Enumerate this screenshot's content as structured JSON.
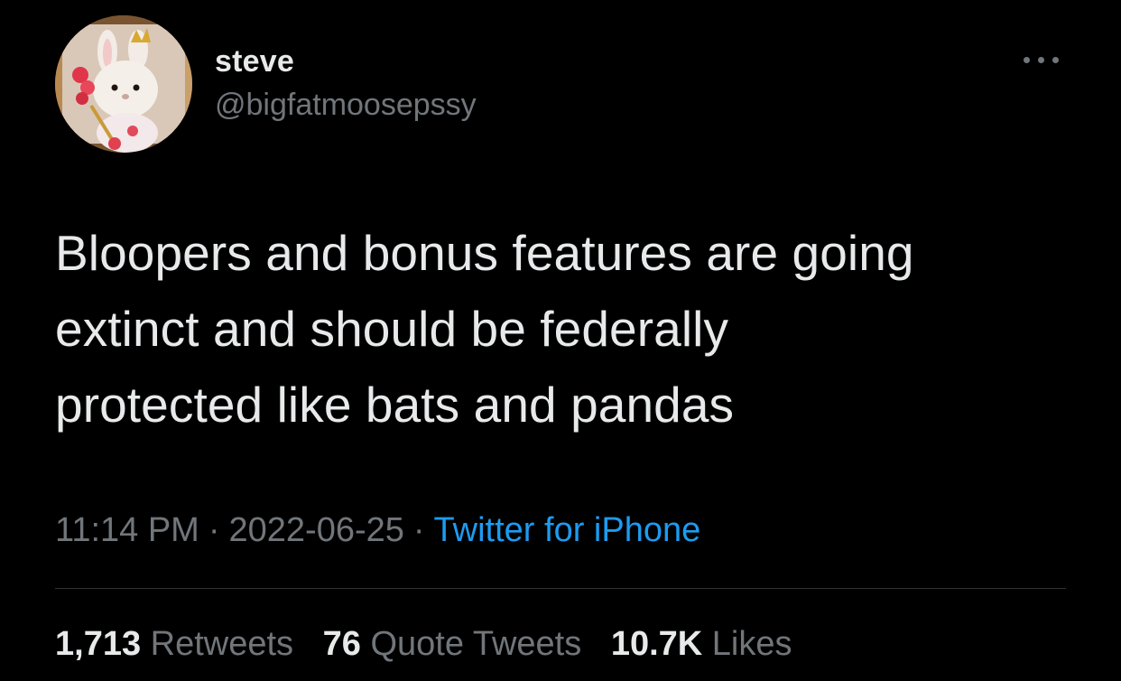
{
  "user": {
    "display_name": "steve",
    "handle": "@bigfatmoosepssy"
  },
  "tweet": {
    "text": "Bloopers and bonus features are going\nextinct and should be federally\nprotected like bats and pandas"
  },
  "meta": {
    "time": "11:14 PM",
    "separator": "·",
    "date": "2022-06-25",
    "source": "Twitter for iPhone"
  },
  "stats": {
    "retweets": {
      "count": "1,713",
      "label": "Retweets"
    },
    "quotes": {
      "count": "76",
      "label": "Quote Tweets"
    },
    "likes": {
      "count": "10.7K",
      "label": "Likes"
    }
  },
  "colors": {
    "background": "#000000",
    "primary_text": "#e7e9ea",
    "secondary_text": "#71767b",
    "link": "#1d9bf0",
    "divider": "#2f3336"
  },
  "icons": {
    "more": "more-horizontal-icon"
  }
}
